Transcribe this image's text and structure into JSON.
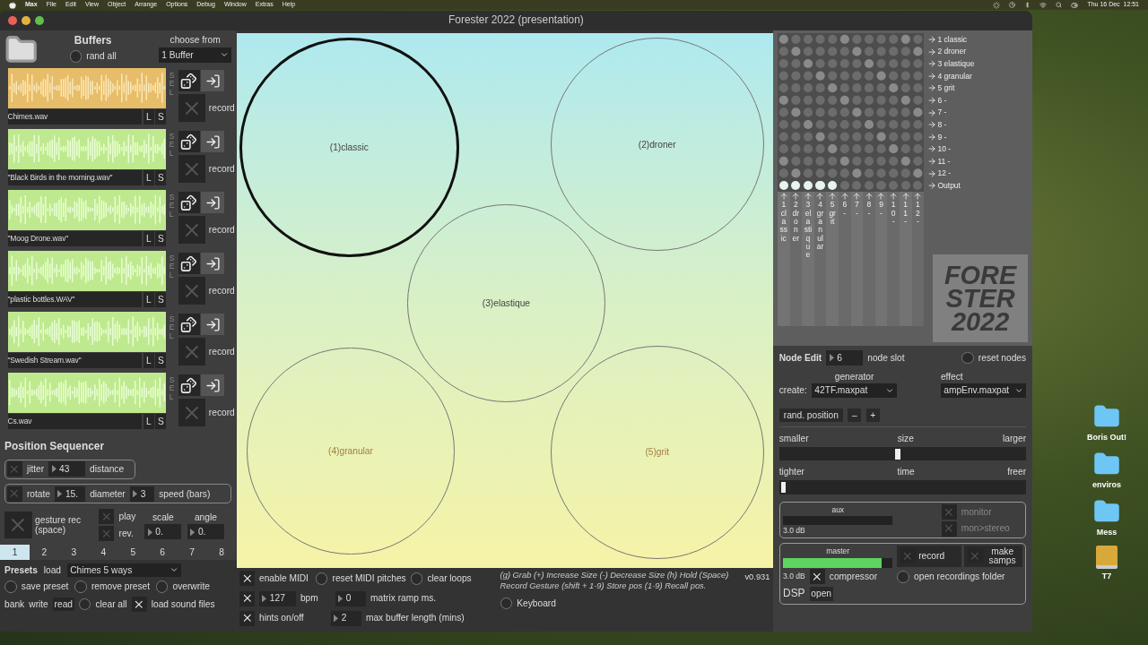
{
  "menu_bar": {
    "app": "Max",
    "items": [
      "File",
      "Edit",
      "View",
      "Object",
      "Arrange",
      "Options",
      "Debug",
      "Window",
      "Extras",
      "Help"
    ],
    "clock": "Thu 16 Dec  12:51"
  },
  "window": {
    "title": "Forester 2022 (presentation)"
  },
  "buffers": {
    "title": "Buffers",
    "rand_all": "rand all",
    "choose_from_label": "choose from",
    "choose_from": "1 Buffer",
    "items": [
      {
        "name": "Chimes.wav",
        "selected": true,
        "sel": "SEL",
        "left": "L",
        "solo": "S",
        "record": "record",
        "recording": false
      },
      {
        "name": "\"Black Birds in the morning.wav\"",
        "selected": false,
        "sel": "SEL",
        "left": "L",
        "solo": "S",
        "record": "record",
        "recording": false
      },
      {
        "name": "\"Moog Drone.wav\"",
        "selected": false,
        "sel": "SEL",
        "left": "L",
        "solo": "S",
        "record": "record",
        "recording": false
      },
      {
        "name": "\"plastic bottles.WAV\"",
        "selected": false,
        "sel": "SEL",
        "left": "L",
        "solo": "S",
        "record": "record",
        "recording": false
      },
      {
        "name": "\"Swedish Stream.wav\"",
        "selected": false,
        "sel": "SEL",
        "left": "L",
        "solo": "S",
        "record": "record",
        "recording": false
      },
      {
        "name": "Cs.wav",
        "selected": false,
        "sel": "SEL",
        "left": "L",
        "solo": "S",
        "record": "record",
        "recording": false
      }
    ]
  },
  "sequencer": {
    "title": "Position Sequencer",
    "jitter": {
      "label": "jitter",
      "on": false,
      "value": "43",
      "unit": "distance"
    },
    "rotate": {
      "label": "rotate",
      "on": false,
      "value": "15.",
      "diameter_label": "diameter",
      "diameter": "3",
      "unit": "speed (bars)"
    },
    "gesture": {
      "label": "gesture rec (space)",
      "on": false
    },
    "play": {
      "label": "play",
      "on": false
    },
    "rev": {
      "label": "rev.",
      "on": false
    },
    "scale_label": "scale",
    "scale": "0.",
    "angle_label": "angle",
    "angle": "0.",
    "slots": [
      {
        "label": "1",
        "selected": true
      },
      {
        "label": "2",
        "selected": false
      },
      {
        "label": "3",
        "selected": false
      },
      {
        "label": "4",
        "selected": false
      },
      {
        "label": "5",
        "selected": false
      },
      {
        "label": "6",
        "selected": false
      },
      {
        "label": "7",
        "selected": false
      },
      {
        "label": "8",
        "selected": false
      }
    ]
  },
  "presets": {
    "title": "Presets",
    "load": "load",
    "preset": "Chimes 5 ways",
    "save": "save preset",
    "remove": "remove preset",
    "overwrite": "overwrite",
    "bank": "bank",
    "write": "write",
    "read": "read",
    "clear": "clear all",
    "load_files": {
      "label": "load sound files",
      "on": true
    }
  },
  "canvas": {
    "nodes": [
      {
        "label": "(1)classic",
        "selected": true
      },
      {
        "label": "(2)droner",
        "selected": false
      },
      {
        "label": "(3)elastique",
        "selected": false
      },
      {
        "label": "(4)granular",
        "selected": false
      },
      {
        "label": "(5)grit",
        "selected": false
      }
    ]
  },
  "controls_bar": {
    "midi": {
      "label": "enable MIDI",
      "on": true
    },
    "reset_midi": "reset MIDI pitches",
    "clear_loops": "clear loops",
    "help": "(g) Grab   (+) Increase Size   (-) Decrease Size   (h) Hold   (Space) Record Gesture   (shift + 1-9) Store pos   (1-9) Recall pos.",
    "version": "v0.931",
    "tempo_on": true,
    "bpm": "127",
    "bpm_label": "bpm",
    "ramp": "0",
    "ramp_label": "matrix ramp ms.",
    "hints": {
      "label": "hints on/off",
      "on": true
    },
    "buffer_len": "2",
    "buffer_len_label": "max buffer length (mins)",
    "keyboard": "Keyboard"
  },
  "matrix": {
    "rows": [
      "1 classic",
      "2 droner",
      "3 elastique",
      "4 granular",
      "5 grit",
      "6 -",
      "7 -",
      "8 -",
      "9 -",
      "10 -",
      "11 -",
      "12 -"
    ],
    "output_label": "Output",
    "columns": [
      {
        "label": "1 classic",
        "output": true
      },
      {
        "label": "2 droner",
        "output": true
      },
      {
        "label": "3 elastique",
        "output": true
      },
      {
        "label": "4 granular",
        "output": true
      },
      {
        "label": "5 grit",
        "output": true
      },
      {
        "label": "6 -",
        "output": false
      },
      {
        "label": "7 -",
        "output": false
      },
      {
        "label": "8 -",
        "output": false
      },
      {
        "label": "9 -",
        "output": false
      },
      {
        "label": "10 -",
        "output": false
      },
      {
        "label": "11 -",
        "output": false
      },
      {
        "label": "12 -",
        "output": false
      }
    ]
  },
  "logo": [
    "FORE",
    "STER",
    "2022"
  ],
  "node_edit": {
    "title": "Node Edit",
    "slot": "6",
    "slot_label": "node slot",
    "reset": "reset nodes",
    "generator_label": "generator",
    "create_label": "create:",
    "generator": "42TF.maxpat",
    "effect_label": "effect",
    "effect": "ampEnv.maxpat",
    "rand": "rand. position",
    "minus": "–",
    "plus": "+",
    "size": {
      "left": "smaller",
      "mid": "size",
      "right": "larger",
      "level": 0.48
    },
    "time": {
      "left": "tighter",
      "mid": "time",
      "right": "freer",
      "level": 0.01
    }
  },
  "aux": {
    "label": "aux",
    "db": "3.0 dB",
    "monitor": {
      "label": "monitor",
      "on": false
    },
    "stereo": {
      "label": "mon>stereo",
      "on": false
    }
  },
  "master": {
    "label": "master",
    "level": 0.9,
    "db": "3.0 dB",
    "compressor": {
      "label": "compressor",
      "on": true
    },
    "record": {
      "label": "record",
      "on": false
    },
    "samps": {
      "label": "make samps",
      "on": false
    },
    "folder": "open recordings folder",
    "dsp": "DSP",
    "open": "open"
  },
  "desktop_icons": [
    {
      "label": "Boris Out!",
      "kind": "folder"
    },
    {
      "label": "enviros",
      "kind": "folder"
    },
    {
      "label": "Mess",
      "kind": "folder"
    },
    {
      "label": "T7",
      "kind": "drive"
    }
  ]
}
